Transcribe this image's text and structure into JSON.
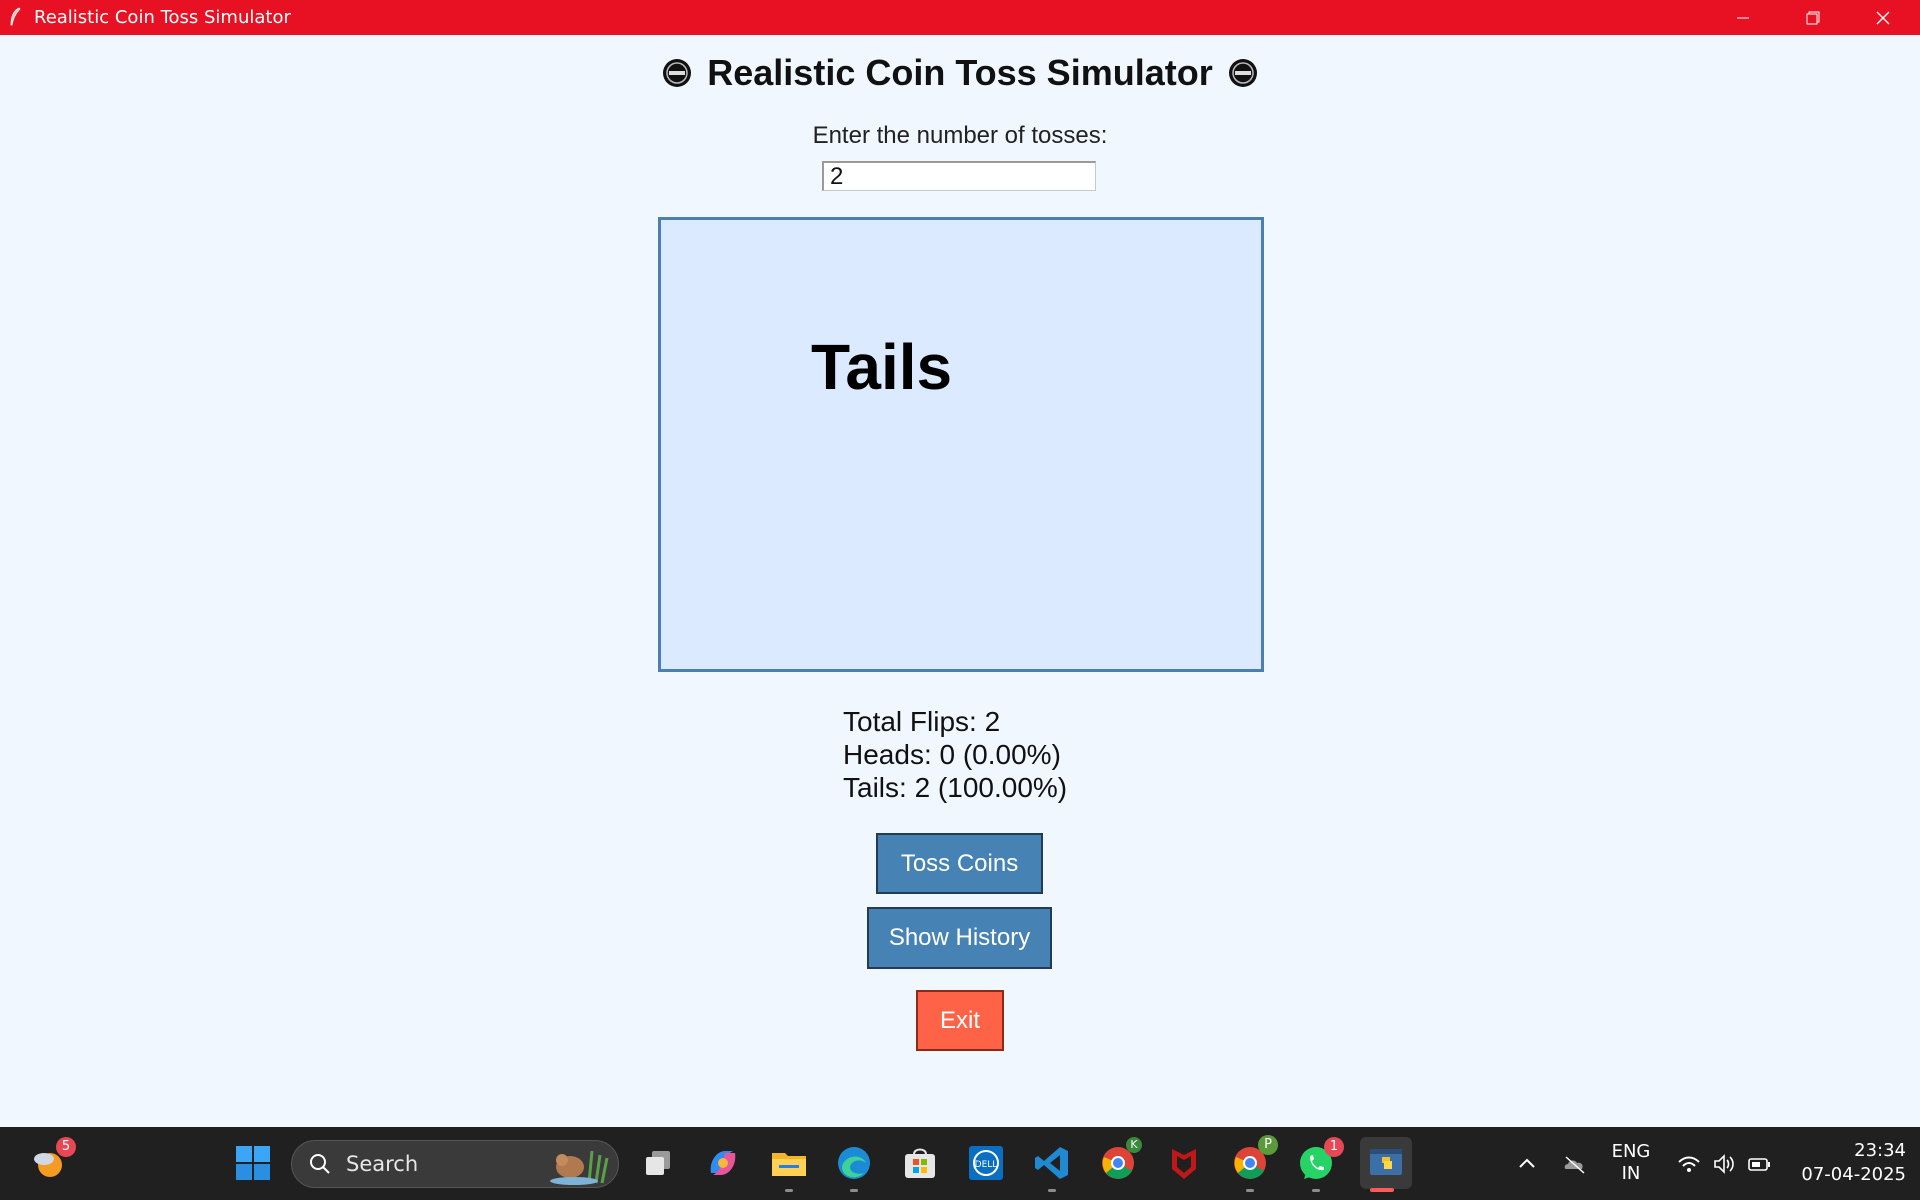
{
  "window": {
    "title": "Realistic Coin Toss Simulator",
    "titlebar_color": "#e81123"
  },
  "app": {
    "heading": "Realistic Coin Toss Simulator",
    "heading_icon": "coin-emoji-icon",
    "prompt": "Enter the number of tosses:",
    "toss_count_value": "2",
    "result_text": "Tails",
    "stats": {
      "total_flips": "Total Flips: 2",
      "heads": "Heads: 0 (0.00%)",
      "tails": "Tails: 2 (100.00%)"
    },
    "buttons": {
      "toss": "Toss Coins",
      "history": "Show History",
      "exit": "Exit"
    },
    "colors": {
      "background": "#f0f7ff",
      "canvas": "#dbeafe",
      "canvas_border": "#4a7fb0",
      "button_blue": "#4682b4",
      "button_exit": "#ff6347"
    }
  },
  "taskbar": {
    "weather_badge": "5",
    "search_placeholder": "Search",
    "whatsapp_badge": "1",
    "chrome_profile_k": "K",
    "chrome_profile_p": "P",
    "language_line1": "ENG",
    "language_line2": "IN",
    "time": "23:34",
    "date": "07-04-2025",
    "dell_label": "DELL"
  }
}
